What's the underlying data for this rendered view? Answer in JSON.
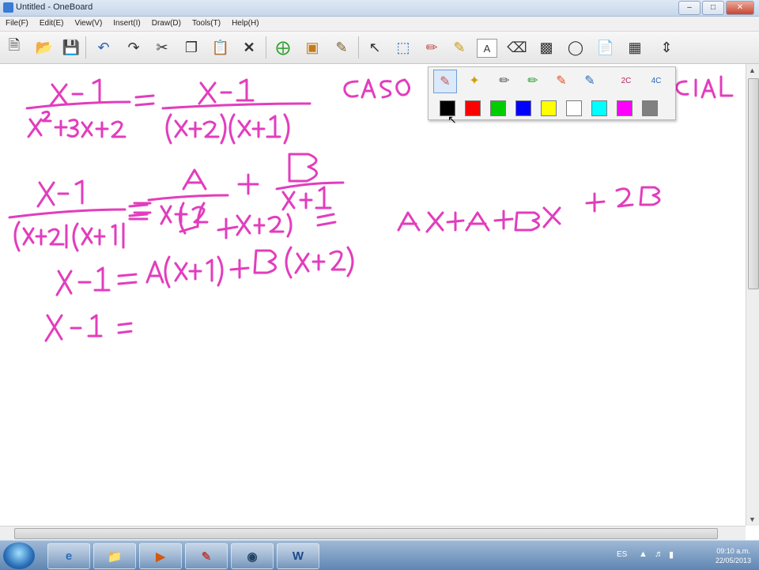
{
  "window": {
    "title": "Untitled - OneBoard"
  },
  "menu": [
    "File(F)",
    "Edit(E)",
    "View(V)",
    "Insert(I)",
    "Draw(D)",
    "Tools(T)",
    "Help(H)"
  ],
  "toolbar_icons": [
    "new-page",
    "open",
    "save",
    "undo",
    "redo",
    "cut",
    "copy",
    "paste",
    "delete",
    "add-page",
    "screen-capture",
    "pointer",
    "select",
    "pen",
    "highlighter",
    "text",
    "eraser",
    "screen-shade",
    "spotlight",
    "table",
    "scroll"
  ],
  "pen_palette": {
    "pens": [
      "brush-pen",
      "magic-pen",
      "smart-pen",
      "pencil",
      "calligraphy-pen",
      "highlighter",
      "two-color-pen",
      "four-color-pen"
    ],
    "two_color_label": "2C",
    "four_color_label": "4C",
    "colors": [
      "#000000",
      "#ff0000",
      "#00cc00",
      "#0000ff",
      "#ffff00",
      "#ffffff",
      "#00ffff",
      "#ff00ff",
      "#808080"
    ],
    "selected_color": "#000000"
  },
  "ink_color": "#e23dbd",
  "taskbar": {
    "apps": [
      "internet-explorer",
      "file-explorer",
      "media-player",
      "oneboard",
      "camera",
      "word"
    ],
    "word_label": "W",
    "clock_time": "09:10 a.m.",
    "clock_date": "22/05/2013"
  }
}
